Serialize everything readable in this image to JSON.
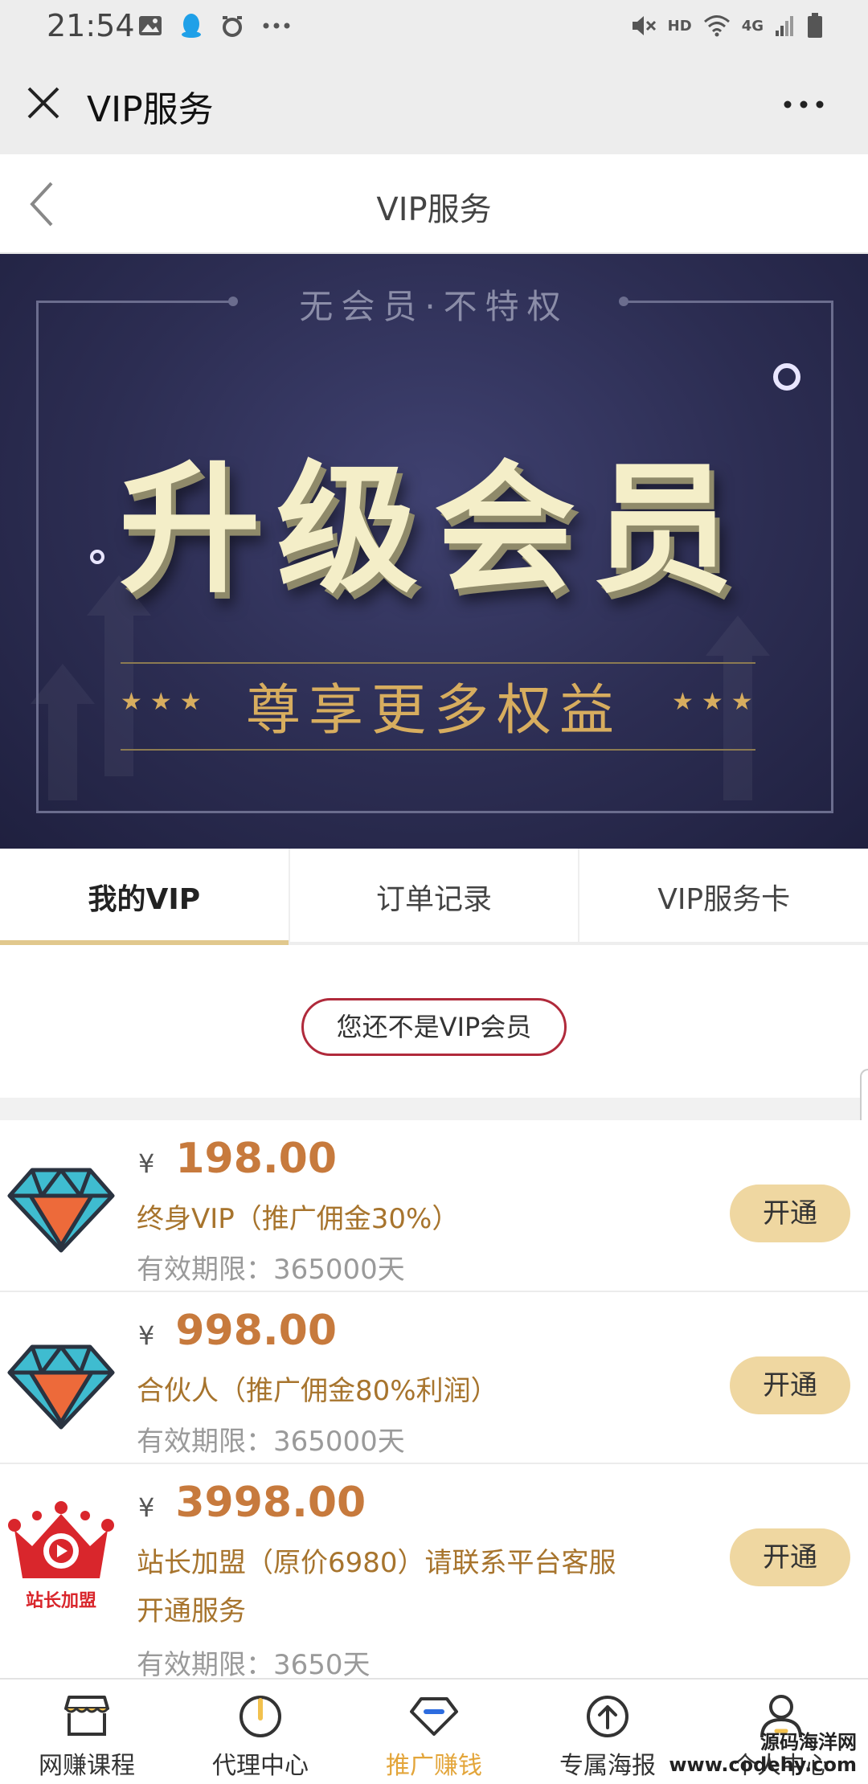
{
  "status_bar": {
    "time": "21:54",
    "network": "4G",
    "hd": "HD",
    "icons": [
      "image-icon",
      "qq-icon",
      "alarm-icon",
      "more-dots-icon",
      "mute-icon",
      "wifi-icon",
      "signal-icon",
      "battery-icon"
    ]
  },
  "wechat_bar": {
    "title": "VIP服务"
  },
  "page_nav": {
    "title": "VIP服务"
  },
  "banner": {
    "tagline": "无会员·不特权",
    "headline": "升级会员",
    "subline": "尊享更多权益",
    "stars": "★★★"
  },
  "tabs": [
    {
      "label": "我的VIP",
      "active": true
    },
    {
      "label": "订单记录",
      "active": false
    },
    {
      "label": "VIP服务卡",
      "active": false
    }
  ],
  "membership_status": "您还不是VIP会员",
  "products": [
    {
      "currency": "¥",
      "price": "198.00",
      "name": "终身VIP（推广佣金30%）",
      "name_line2": "",
      "validity": "有效期限：365000天",
      "button": "开通",
      "icon": "diamond-icon"
    },
    {
      "currency": "¥",
      "price": "998.00",
      "name": "合伙人（推广佣金80%利润）",
      "name_line2": "",
      "validity": "有效期限：365000天",
      "button": "开通",
      "icon": "diamond-icon"
    },
    {
      "currency": "¥",
      "price": "3998.00",
      "name": "站长加盟（原价6980）请联系平台客服",
      "name_line2": "开通服务",
      "validity": "有效期限：3650天",
      "button": "开通",
      "icon": "crown-icon",
      "icon_label": "站长加盟"
    }
  ],
  "bottom_nav": [
    {
      "label": "网赚课程",
      "icon": "shop-icon",
      "active": false
    },
    {
      "label": "代理中心",
      "icon": "power-icon",
      "active": false
    },
    {
      "label": "推广赚钱",
      "icon": "gem-icon",
      "active": true
    },
    {
      "label": "专属海报",
      "icon": "upload-icon",
      "active": false
    },
    {
      "label": "个人中心",
      "icon": "user-icon",
      "active": false
    }
  ],
  "watermark": {
    "line1": "源码海洋网",
    "line2": "www.codehy.com"
  },
  "colors": {
    "accent_gold": "#e1c88d",
    "price_orange": "#c77a3d",
    "pill_red": "#b02a3b",
    "active_nav": "#e3a53a"
  }
}
